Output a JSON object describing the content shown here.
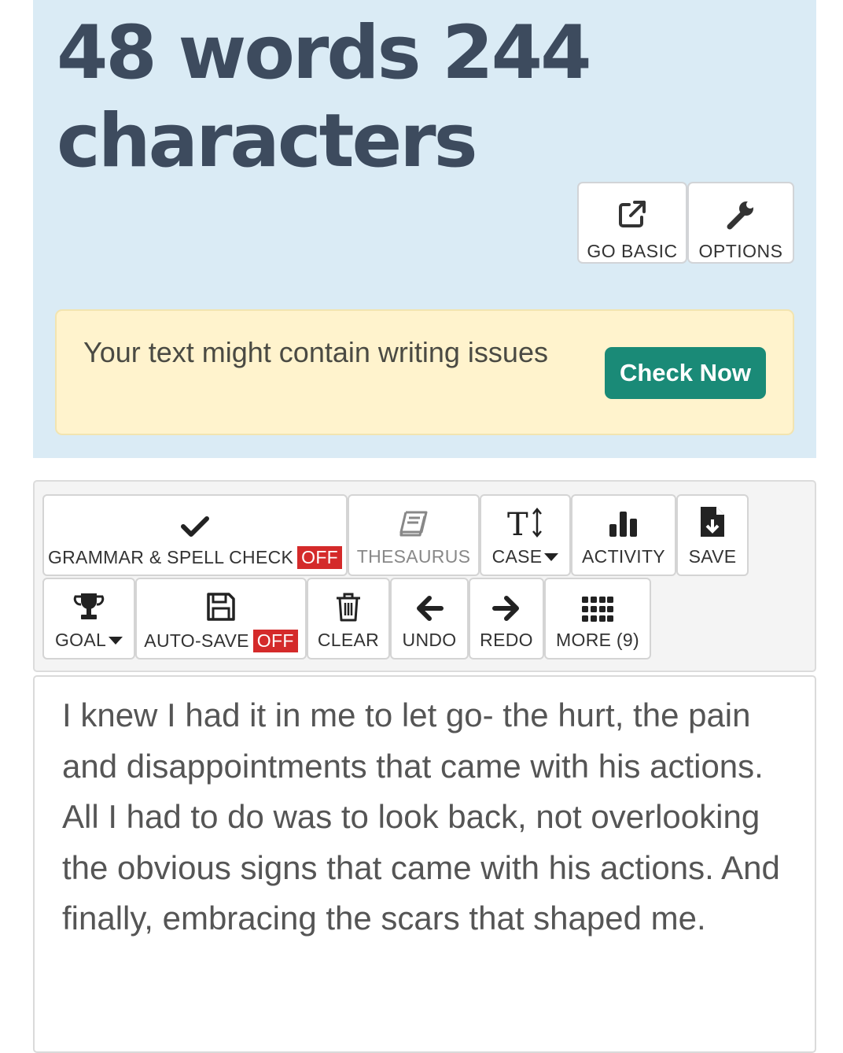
{
  "stats": {
    "headline": "48 words 244 characters"
  },
  "top_buttons": {
    "go_basic": {
      "label": "GO BASIC",
      "icon": "external-link-icon"
    },
    "options": {
      "label": "OPTIONS",
      "icon": "wrench-icon"
    }
  },
  "notice": {
    "text": "Your text might contain writing issues",
    "button_label": "Check Now"
  },
  "toolbar": {
    "grammar": {
      "label": "GRAMMAR & SPELL CHECK",
      "status": "OFF",
      "icon": "checkmark-icon"
    },
    "thesaurus": {
      "label": "THESAURUS",
      "icon": "book-icon"
    },
    "case": {
      "label": "CASE",
      "icon": "text-height-icon"
    },
    "activity": {
      "label": "ACTIVITY",
      "icon": "bar-chart-icon"
    },
    "save": {
      "label": "SAVE",
      "icon": "file-download-icon"
    },
    "goal": {
      "label": "GOAL",
      "icon": "trophy-icon"
    },
    "autosave": {
      "label": "AUTO-SAVE",
      "status": "OFF",
      "icon": "floppy-disk-icon"
    },
    "clear": {
      "label": "CLEAR",
      "icon": "trash-icon"
    },
    "undo": {
      "label": "UNDO",
      "icon": "arrow-left-icon"
    },
    "redo": {
      "label": "REDO",
      "icon": "arrow-right-icon"
    },
    "more": {
      "label": "MORE (9)",
      "icon": "grid-icon"
    }
  },
  "editor": {
    "text": "I knew I had it in me to let go- the hurt, the pain and disappointments that came with his actions. All I had to do was to look back, not overlooking the obvious signs that came with his actions. And finally, embracing the scars that shaped me."
  },
  "colors": {
    "stats_bg": "#daebf5",
    "headline": "#3d4b5e",
    "notice_bg": "#fff3cd",
    "check_button": "#1a8a77",
    "off_badge": "#d42a2a"
  }
}
